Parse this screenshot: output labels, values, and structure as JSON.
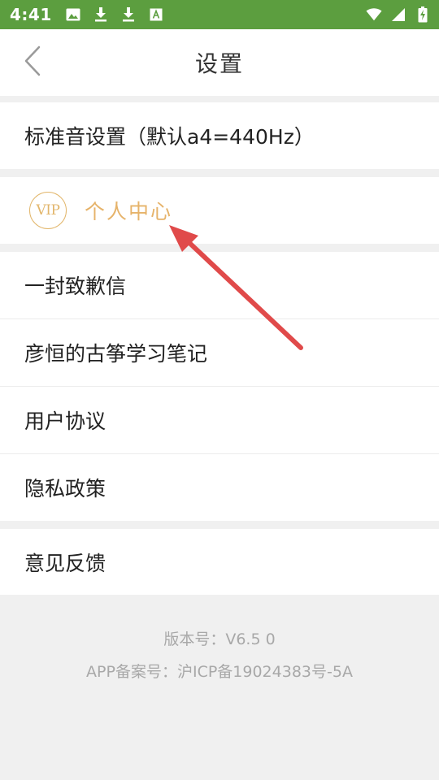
{
  "status_bar": {
    "time": "4:41",
    "left_icons": [
      "image-icon",
      "download-icon",
      "download-icon",
      "text-a-icon"
    ],
    "right_icons": [
      "wifi-icon",
      "signal-icon",
      "battery-charging-icon"
    ],
    "background_color": "#5c9e3f"
  },
  "header": {
    "title": "设置",
    "back_icon": "chevron-left-icon"
  },
  "settings": {
    "standard_pitch": "标准音设置（默认a4=440Hz）",
    "vip": {
      "badge": "VIP",
      "label": "个人中心",
      "color": "#e6b36a"
    },
    "items": [
      {
        "label": "一封致歉信"
      },
      {
        "label": "彦恒的古筝学习笔记"
      },
      {
        "label": "用户协议"
      },
      {
        "label": "隐私政策"
      }
    ],
    "feedback": "意见反馈"
  },
  "footer": {
    "version": "版本号：V6.5 0",
    "record": "APP备案号：沪ICP备19024383号-5A"
  },
  "annotation": {
    "arrow_color": "#e04a4a"
  }
}
